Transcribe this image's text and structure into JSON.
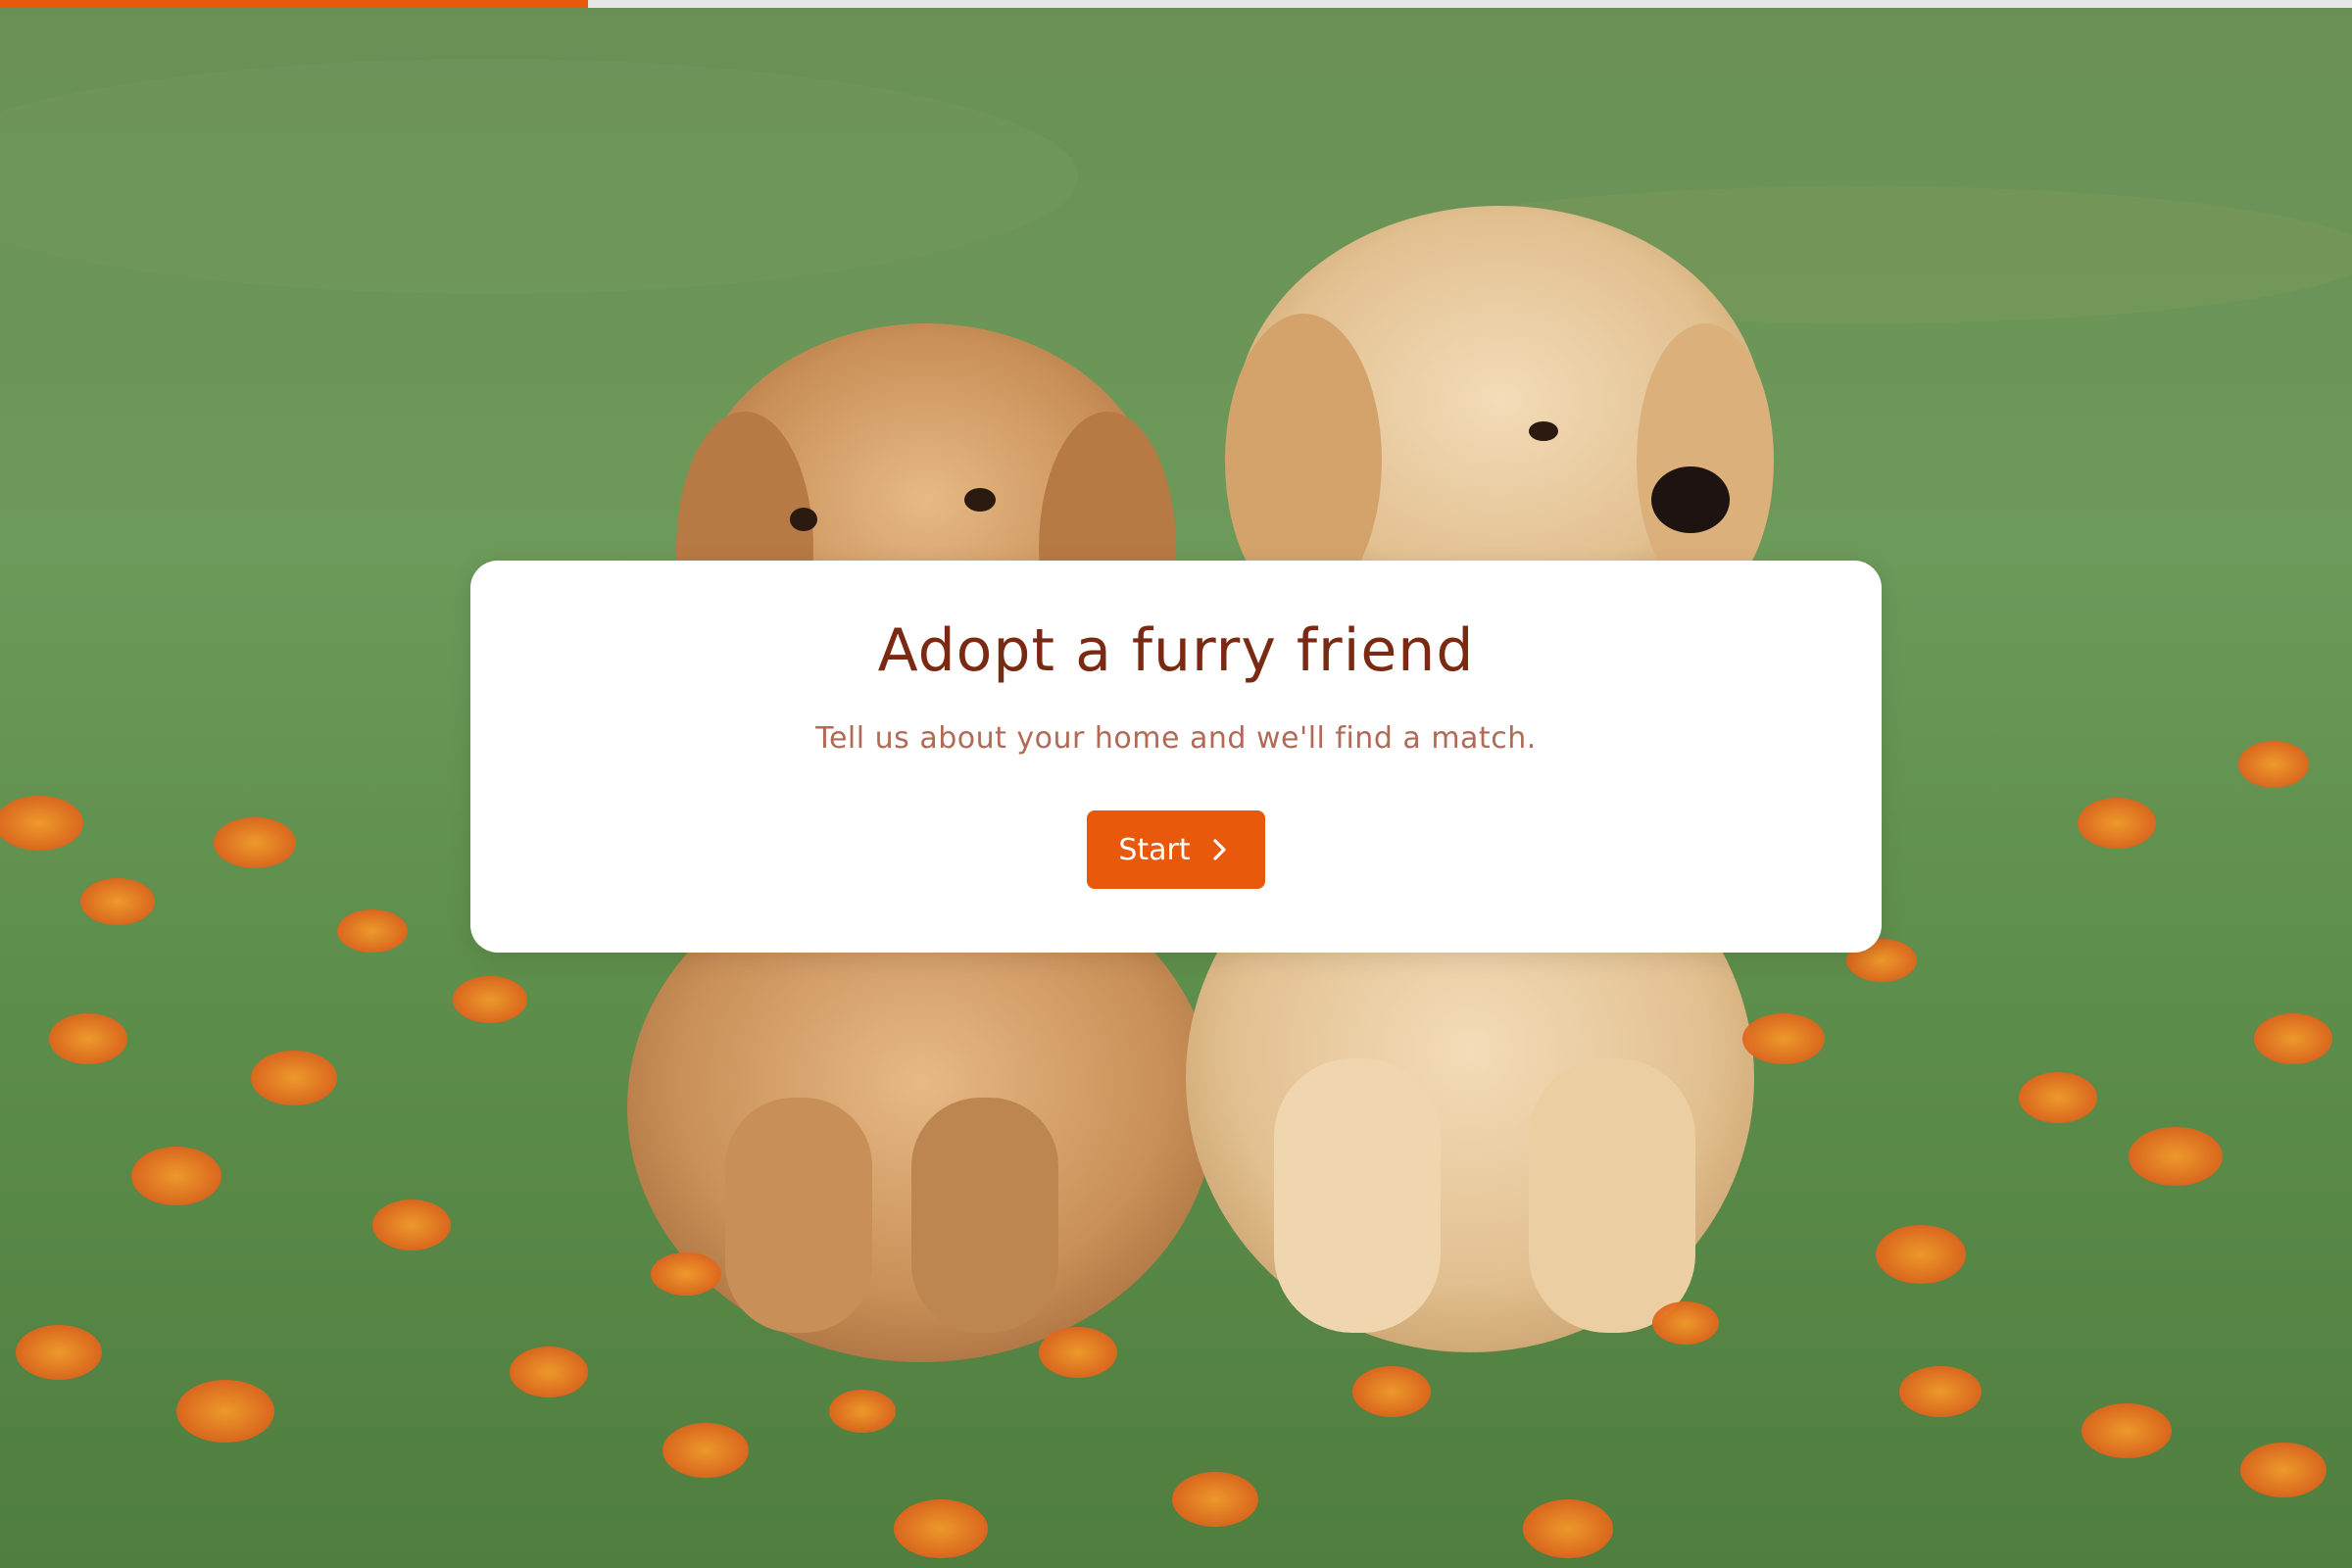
{
  "progress": {
    "value_percent": 25,
    "fill_color": "#e8590c",
    "track_color": "#e6e6e6"
  },
  "background": {
    "image_description_icon": "puppies-photo"
  },
  "card": {
    "title": "Adopt a furry friend",
    "subtitle": "Tell us about your home and we'll find a match.",
    "start_label": "Start",
    "start_icon": "chevron-right-icon"
  },
  "colors": {
    "accent": "#e8590c",
    "title": "#7a2a12",
    "subtitle": "#b06a55"
  }
}
